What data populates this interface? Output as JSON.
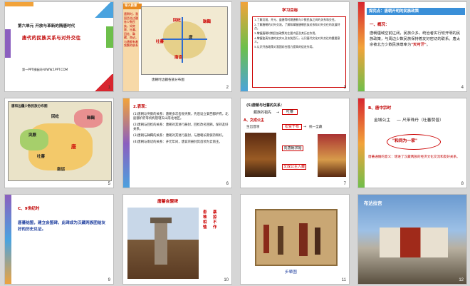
{
  "slides": [
    {
      "num": "1",
      "line1": "第六单元  开放与革新的隋唐时代",
      "line2": "唐代的民族关系与对外交往",
      "footer": "第一PPT模板网-WWW.1PPT.COM"
    },
    {
      "num": "2",
      "label": "导入新课",
      "side_text": "唐朝时，我国西北边疆各少数民族，如突厥、吐蕃、回纥、靺鞨、南诏，与唐都有着频繁的联系",
      "caption": "唐朝时边疆各族分布图",
      "map_labels": [
        "回纥",
        "靺鞨",
        "吐蕃",
        "南诏",
        "唐"
      ]
    },
    {
      "num": "3",
      "title": "学习目标",
      "items": [
        "1.了解贞观、开元、盛唐等时期唐朝与少数民族之间的关系和交往。",
        "2.了解唐朝的对外交流，了解和掌握唐朝民族关系和对外交往的发展特点。",
        "3.掌握唐朝时期民族政策的主要内容及其历史作用。",
        "4.掌握鉴真东渡的史实以及玄奘西行，认识唐代文化对外交往的重要意义。",
        "5.认识开放政策对我国综合国力提高的促进作用。"
      ]
    },
    {
      "num": "4",
      "title": "探究点：唐朝开明的民族政策",
      "heading": "一、概况：",
      "body": "唐朝疆域空前辽阔，民族众多，统治者实行较开明的民族政策，与周边少数民族保持着友好密切的联系。唐太宗被北方少数民族尊奉为",
      "quote": "\"天可汗\"",
      "end": "。"
    },
    {
      "num": "5",
      "title": "唐和边疆少数民族分布图",
      "labels": [
        "回纥",
        "靺鞨",
        "突厥",
        "吐蕃",
        "南诏",
        "唐"
      ]
    },
    {
      "num": "6",
      "heading": "2.表现：",
      "items": [
        "(1)唐朝与突厥的关系：唐朝多次击败突厥，先后设立安西都护府，北庭都护府等机构管辖天山南北地区。",
        "(2)唐朝与回纥的关系：唐朝对其进行册封，回纥改名回鹘，保持友好关系。",
        "(3)唐朝与靺鞨的关系：唐朝对其进行册封，与唐朝长期保持和好。",
        "(4)唐朝与南诏的关系：开元年间，唐玄宗册封其首领为云南王。"
      ]
    },
    {
      "num": "7",
      "heading": "(5)唐朝与吐蕃的关系：",
      "sub": "藏族的祖先",
      "arrow": "吐蕃",
      "left_label": "A、文成公主",
      "mid": "松赞干布",
      "right": "统一全藏",
      "down1": "向唐朝求婚",
      "down2": "文成公主入藏",
      "step1": "生出首领"
    },
    {
      "num": "8",
      "label": "B、唐中宗时",
      "left": "金城公主",
      "right": "尺带珠丹（吐蕃赞普）",
      "center": "\"和同为一家\"",
      "note": "唐蕃通婚的意义：增进了汉藏两族的经济文化交流和友好关系。"
    },
    {
      "num": "9",
      "label": "C、9世纪时",
      "body": "唐蕃结盟，建立会盟碑，此碑成为汉藏两族团结友好的历史见证。"
    },
    {
      "num": "10",
      "title": "唐蕃会盟碑",
      "vertical": [
        "患难相恤",
        "暴掠不作"
      ]
    },
    {
      "num": "11",
      "caption": "步辇图"
    },
    {
      "num": "12",
      "title": "布达拉宫"
    }
  ],
  "colors": {
    "accent_orange": "#f2a33a",
    "accent_green": "#6dbf4b",
    "accent_blue": "#4aa3df",
    "accent_red": "#d8262f",
    "accent_purple": "#8b5fbf"
  }
}
